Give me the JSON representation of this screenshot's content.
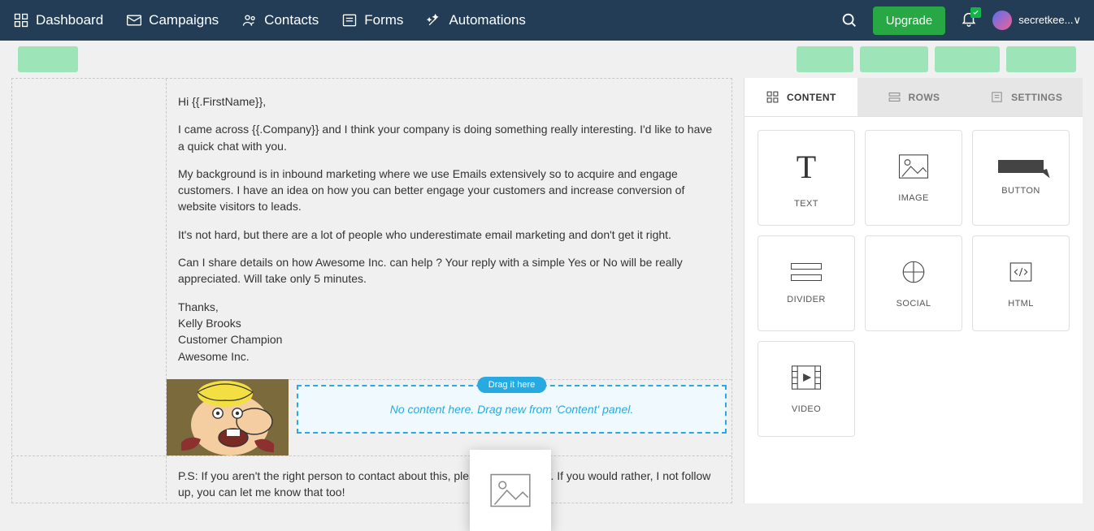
{
  "nav": {
    "dashboard": "Dashboard",
    "campaigns": "Campaigns",
    "contacts": "Contacts",
    "forms": "Forms",
    "automations": "Automations",
    "upgrade": "Upgrade",
    "user": "secretkee...∨"
  },
  "email": {
    "greeting": "Hi {{.FirstName}},",
    "p1": "I came across {{.Company}} and I think your company is doing something really interesting. I'd like to have a quick chat with you.",
    "p2": "My background is in inbound marketing where we use Emails extensively so to acquire and engage customers. I have an idea on how you can better engage your customers and increase conversion of website visitors to leads.",
    "p3": "It's not hard, but there are a lot of people who underestimate email marketing and don't get it right.",
    "p4": "Can I share details on how Awesome Inc. can help ? Your reply with a simple Yes or No will be really appreciated. Will take only 5 minutes.",
    "thanks": "Thanks,",
    "sig1": "Kelly Brooks",
    "sig2": "Customer Champion",
    "sig3": "Awesome Inc.",
    "ps": "P.S: If you aren't the right person to contact about this, please let me know. If you would rather, I not follow up, you can let me know that too!"
  },
  "drop": {
    "hint": "Drag it here",
    "text": "No content here. Drag new from 'Content' panel."
  },
  "tabs": {
    "content": "CONTENT",
    "rows": "ROWS",
    "settings": "SETTINGS"
  },
  "blocks": {
    "text": "TEXT",
    "image": "IMAGE",
    "button": "BUTTON",
    "divider": "DIVIDER",
    "social": "SOCIAL",
    "html": "HTML",
    "video": "VIDEO"
  }
}
